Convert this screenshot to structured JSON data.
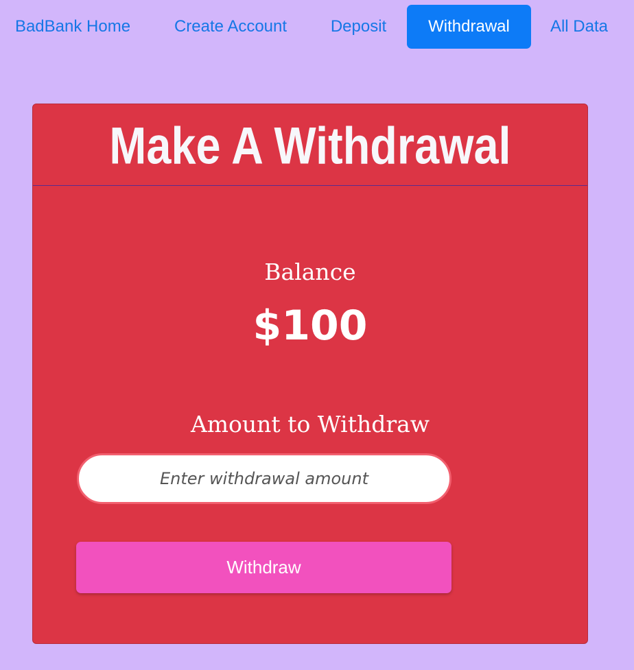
{
  "nav": {
    "items": [
      {
        "label": "BadBank Home",
        "active": false
      },
      {
        "label": "Create Account",
        "active": false
      },
      {
        "label": "Deposit",
        "active": false
      },
      {
        "label": "Withdrawal",
        "active": true
      },
      {
        "label": "All Data",
        "active": false
      }
    ]
  },
  "card": {
    "title": "Make A Withdrawal",
    "balance_label": "Balance",
    "balance_value": "$100",
    "amount_label": "Amount to Withdraw",
    "amount_input": {
      "value": "",
      "placeholder": "Enter withdrawal amount"
    },
    "submit_label": "Withdraw"
  },
  "colors": {
    "background": "#d2b6fb",
    "nav_link": "#1677e6",
    "nav_active_bg": "#0d7bf7",
    "card_bg": "#dc3545",
    "button_bg": "#f251be",
    "input_border": "#f2606f"
  }
}
